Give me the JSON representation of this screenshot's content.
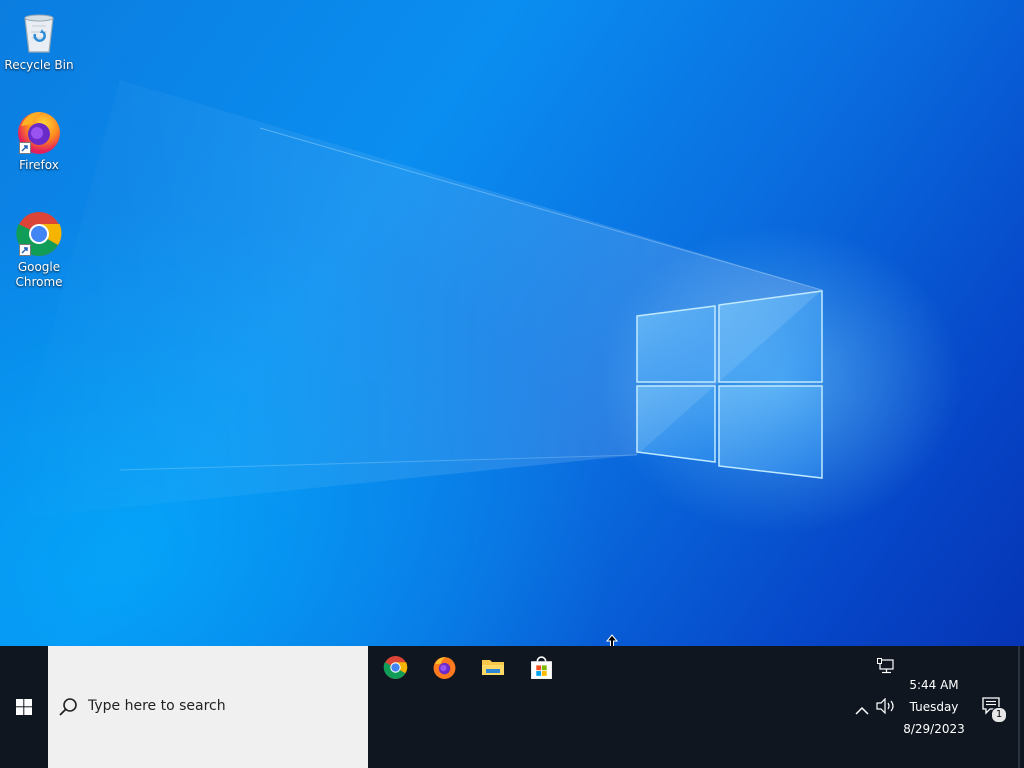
{
  "desktop": {
    "icons": [
      {
        "label": "Recycle Bin",
        "icon": "recycle-bin-icon"
      },
      {
        "label": "Firefox",
        "icon": "firefox-icon"
      },
      {
        "label": "Google Chrome",
        "icon": "chrome-icon"
      }
    ]
  },
  "taskbar": {
    "start_icon": "windows-logo-icon",
    "search_placeholder": "Type here to search",
    "pinned": [
      {
        "app": "Google Chrome",
        "icon": "chrome-icon"
      },
      {
        "app": "Firefox",
        "icon": "firefox-icon"
      },
      {
        "app": "File Explorer",
        "icon": "file-explorer-icon"
      },
      {
        "app": "Microsoft Store",
        "icon": "store-icon"
      }
    ]
  },
  "tray": {
    "time": "5:44 AM",
    "day": "Tuesday",
    "date": "8/29/2023",
    "notification_count": "1",
    "icons": [
      "network-icon",
      "chevron-up-icon",
      "volume-icon",
      "notification-icon"
    ]
  },
  "colors": {
    "wallpaper_primary": "#0a7fe6",
    "wallpaper_dark": "#0535b5",
    "taskbar": "#0f1620",
    "search_box": "#f0f0f0"
  }
}
